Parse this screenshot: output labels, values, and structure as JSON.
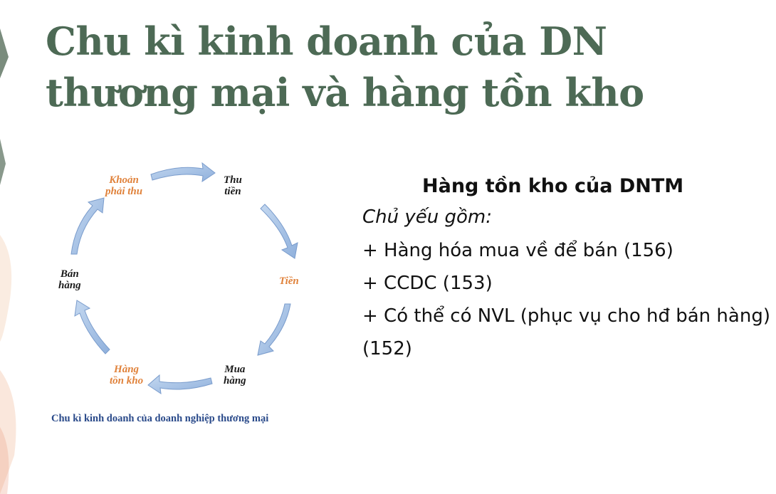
{
  "slide": {
    "title": "Chu kì kinh doanh của DN thương mại và hàng tồn kho"
  },
  "diagram": {
    "nodes": [
      {
        "id": "khoan-phai-thu",
        "lines": [
          "Khoản",
          "phải thu"
        ],
        "color": "#e0823b"
      },
      {
        "id": "thu-tien",
        "lines": [
          "Thu",
          "tiền"
        ],
        "color": "#1a1a1a"
      },
      {
        "id": "tien",
        "lines": [
          "Tiền"
        ],
        "color": "#e0823b"
      },
      {
        "id": "mua-hang",
        "lines": [
          "Mua",
          "hàng"
        ],
        "color": "#1a1a1a"
      },
      {
        "id": "hang-ton-kho",
        "lines": [
          "Hàng",
          "tồn kho"
        ],
        "color": "#e0823b"
      },
      {
        "id": "ban-hang",
        "lines": [
          "Bán",
          "hàng"
        ],
        "color": "#1a1a1a"
      }
    ],
    "caption": "Chu kì kinh doanh của doanh nghiệp thương mại",
    "arrow_color": "#a9c4e6"
  },
  "panel": {
    "heading": "Hàng tồn kho của DNTM",
    "subheading": "Chủ yếu gồm:",
    "items": [
      "+ Hàng hóa mua về để bán (156)",
      "+ CCDC (153)",
      "+ Có thể có NVL (phục vụ cho hđ bán hàng) (152)"
    ]
  }
}
